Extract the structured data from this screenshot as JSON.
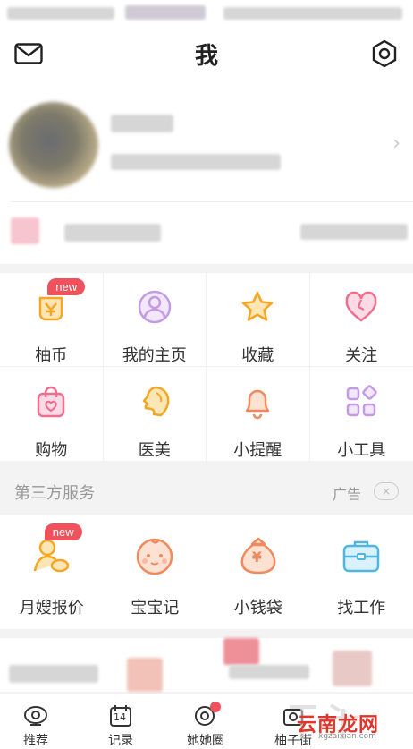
{
  "header": {
    "title": "我"
  },
  "menu": [
    {
      "label": "柚币",
      "icon": "coin-bag-icon",
      "badge": "new"
    },
    {
      "label": "我的主页",
      "icon": "person-icon"
    },
    {
      "label": "收藏",
      "icon": "star-icon"
    },
    {
      "label": "关注",
      "icon": "heart-icon"
    },
    {
      "label": "购物",
      "icon": "shopping-bag-icon"
    },
    {
      "label": "医美",
      "icon": "face-icon"
    },
    {
      "label": "小提醒",
      "icon": "bell-icon"
    },
    {
      "label": "小工具",
      "icon": "tools-icon"
    }
  ],
  "third_party": {
    "title": "第三方服务",
    "ad_label": "广告",
    "close_glyph": "×",
    "items": [
      {
        "label": "月嫂报价",
        "icon": "nanny-icon",
        "badge": "new"
      },
      {
        "label": "宝宝记",
        "icon": "baby-icon"
      },
      {
        "label": "小钱袋",
        "icon": "money-bag-icon",
        "icon_text": "¥"
      },
      {
        "label": "找工作",
        "icon": "briefcase-icon"
      }
    ]
  },
  "tabbar": [
    {
      "label": "推荐",
      "icon": "bowl-icon"
    },
    {
      "label": "记录",
      "icon": "calendar-icon",
      "icon_text": "14"
    },
    {
      "label": "她她圈",
      "icon": "circle-icon"
    },
    {
      "label": "柚子街",
      "icon": "shop-icon"
    }
  ],
  "watermark": {
    "text": "云南龙网",
    "sub": "xgzaixian.com"
  },
  "colors": {
    "accent": "#f0525d",
    "icon_orange": "#f5a623",
    "icon_pink": "#ef6e8e",
    "icon_purple": "#c39be0"
  }
}
